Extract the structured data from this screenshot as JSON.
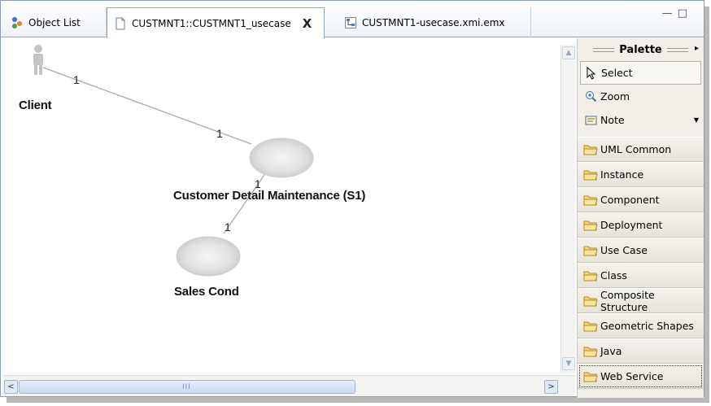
{
  "tabs": [
    {
      "label": "Object List",
      "icon": "object-list-icon"
    },
    {
      "label": "CUSTMNT1::CUSTMNT1_usecase",
      "icon": "diagram-file-icon",
      "active": true,
      "close": "X"
    },
    {
      "label": "CUSTMNT1-usecase.xmi.emx",
      "icon": "model-file-icon"
    }
  ],
  "window_controls": {
    "minimize": "—",
    "maximize": "□"
  },
  "diagram": {
    "actor": {
      "label": "Client"
    },
    "usecases": [
      {
        "label": "Customer Detail Maintenance (S1)"
      },
      {
        "label": "Sales Cond"
      }
    ],
    "multiplicities": [
      "1",
      "1",
      "1",
      "1"
    ]
  },
  "scrollbars": {
    "up": "▲",
    "down": "▼",
    "left": "<",
    "right": ">",
    "grip": "III"
  },
  "palette": {
    "title": "Palette",
    "expand": "▸",
    "tools": [
      {
        "label": "Select",
        "icon": "arrow-cursor-icon",
        "selected": true
      },
      {
        "label": "Zoom",
        "icon": "zoom-icon"
      },
      {
        "label": "Note",
        "icon": "note-icon",
        "dropdown": "▼"
      }
    ],
    "drawers": [
      "UML Common",
      "Instance",
      "Component",
      "Deployment",
      "Use Case",
      "Class",
      "Composite Structure",
      "Geometric Shapes",
      "Java",
      "Web Service"
    ]
  },
  "colors": {
    "accent": "#8fa2bd",
    "folder": "#f3c64a",
    "usecase_fill": "#d9d9d9",
    "actor": "#c9c9c9"
  }
}
